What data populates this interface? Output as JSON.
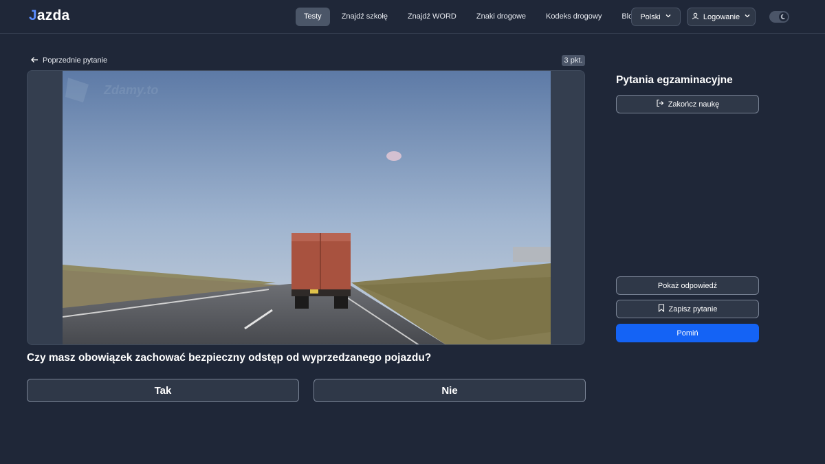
{
  "brand": {
    "logo_mark": "J",
    "logo_text": "azda"
  },
  "nav": {
    "links": [
      {
        "label": "Testy",
        "active": true
      },
      {
        "label": "Znajdź szkołę"
      },
      {
        "label": "Znajdź WORD"
      },
      {
        "label": "Znaki drogowe"
      },
      {
        "label": "Kodeks drogowy"
      },
      {
        "label": "Blog"
      }
    ],
    "language": "Polski",
    "login": "Logowanie"
  },
  "question_panel": {
    "previous_label": "Poprzednie pytanie",
    "points": "3 pkt.",
    "watermark": "Zdamy.to",
    "question_text": "Czy masz obowiązek zachować bezpieczny odstęp od wyprzedzanego pojazdu?",
    "answers": {
      "yes": "Tak",
      "no": "Nie"
    }
  },
  "sidebar": {
    "title": "Pytania egzaminacyjne",
    "end_label": "Zakończ naukę",
    "show_answer_label": "Pokaż odpowiedź",
    "save_label": "Zapisz pytanie",
    "skip_label": "Pomiń"
  },
  "colors": {
    "background": "#1f2738",
    "accent": "#1463f5",
    "button_bg": "#2f3848"
  }
}
